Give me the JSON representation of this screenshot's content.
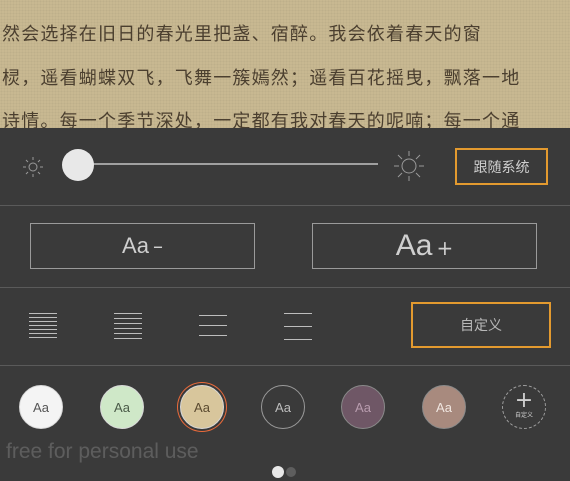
{
  "reader": {
    "lines": [
      "然会选择在旧日的春光里把盏、宿醉。我会依着春天的窗",
      "棂，遥看蝴蝶双飞，飞舞一簇嫣然；遥看百花摇曳，飘落一地",
      "诗情。每一个季节深处，一定都有我对春天的呢喃；每一个通"
    ]
  },
  "brightness": {
    "level": 0,
    "follow_label": "跟随系统"
  },
  "font_size": {
    "decrease_label": "Aa",
    "decrease_sign": "–",
    "increase_label": "Aa",
    "increase_sign": "+"
  },
  "spacing": {
    "custom_label": "自定义"
  },
  "themes": [
    {
      "label": "Aa",
      "bg": "#f4f4f4",
      "fg": "#555555",
      "border": "#d8d8d8",
      "selected": false
    },
    {
      "label": "Aa",
      "bg": "#cfe8c8",
      "fg": "#4a5a48",
      "border": "#d8d8d8",
      "selected": false
    },
    {
      "label": "Aa",
      "bg": "#d8c69c",
      "fg": "#5a4a30",
      "border": "#d8d8d8",
      "selected": true
    },
    {
      "label": "Aa",
      "bg": "#3a3a3a",
      "fg": "#bdbdbd",
      "border": "#9a9a9a",
      "selected": false
    },
    {
      "label": "Aa",
      "bg": "#6f5766",
      "fg": "#b89cae",
      "border": "#8a8a8a",
      "selected": false
    },
    {
      "label": "Aa",
      "bg": "#a88a7e",
      "fg": "#f0e6e0",
      "border": "#8a8a8a",
      "selected": false
    }
  ],
  "add_theme": {
    "plus": "+",
    "label": "自定义"
  },
  "watermark": "free for personal use",
  "pager": {
    "current": 1,
    "total": 2
  },
  "colors": {
    "accent": "#e39a2f",
    "selected_ring": "#e96a3a",
    "paper": "#c8b891",
    "panel": "#3a3a3a"
  }
}
